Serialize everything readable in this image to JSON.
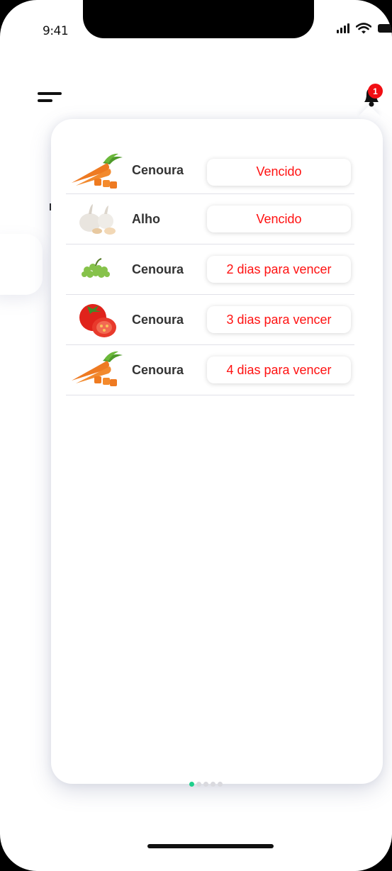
{
  "status_bar": {
    "time": "9:41",
    "icons": [
      "cellular-signal-icon",
      "wifi-icon",
      "battery-icon"
    ]
  },
  "header": {
    "menu_icon": "hamburger-menu-icon",
    "notification_icon": "bell-icon",
    "notification_count": "1"
  },
  "colors": {
    "expired_text": "#ff1111",
    "badge": "#f10e13",
    "active_dot": "#1fcf8c"
  },
  "notifications": [
    {
      "name": "Cenoura",
      "status": "Vencido",
      "image": "carrot-icon"
    },
    {
      "name": "Alho",
      "status": "Vencido",
      "image": "garlic-icon"
    },
    {
      "name": "Cenoura",
      "status": "2 dias para vencer",
      "image": "grapes-icon"
    },
    {
      "name": "Cenoura",
      "status": "3 dias para vencer",
      "image": "tomato-icon"
    },
    {
      "name": "Cenoura",
      "status": "4 dias para vencer",
      "image": "carrot-icon"
    }
  ],
  "pagination": {
    "total": 5,
    "active": 0
  }
}
